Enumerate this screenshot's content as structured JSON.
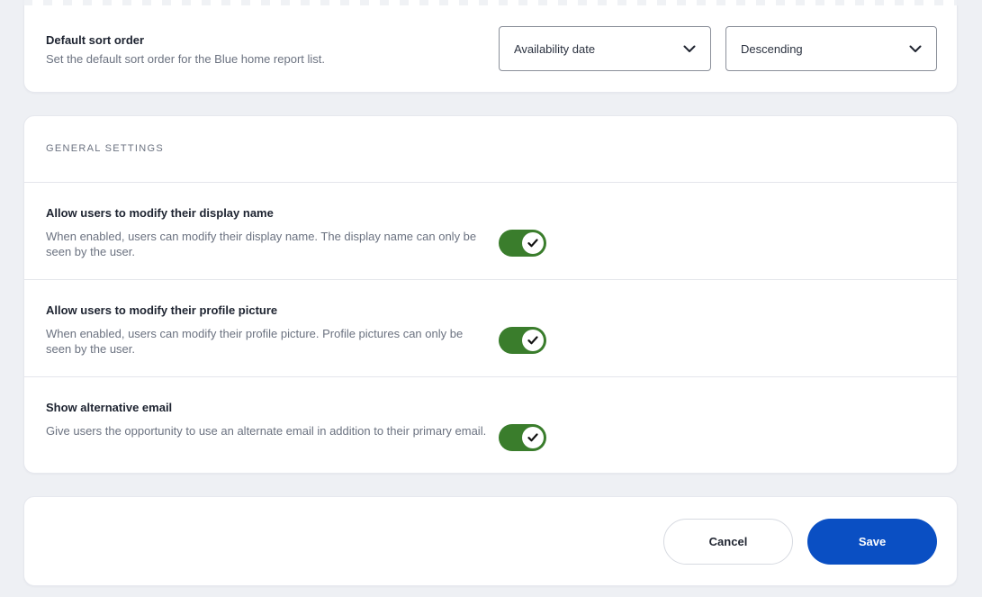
{
  "sort": {
    "title": "Default sort order",
    "description": "Set the default sort order for the Blue home report list.",
    "field_value": "Availability date",
    "direction_value": "Descending",
    "chevron_icon": "chevron-down-icon"
  },
  "general": {
    "heading": "GENERAL SETTINGS",
    "settings": [
      {
        "title": "Allow users to modify their display name",
        "description": "When enabled, users can modify their display name. The display name can only be seen by the user.",
        "enabled": true
      },
      {
        "title": "Allow users to modify their profile picture",
        "description": "When enabled, users can modify their profile picture. Profile pictures can only be seen by the user.",
        "enabled": true
      },
      {
        "title": "Show alternative email",
        "description": "Give users the opportunity to use an alternate email in addition to their primary email.",
        "enabled": true
      }
    ]
  },
  "footer": {
    "cancel_label": "Cancel",
    "save_label": "Save"
  },
  "colors": {
    "toggle_on": "#3a7d2c",
    "primary": "#0a4fc3",
    "background": "#eef0f4"
  }
}
